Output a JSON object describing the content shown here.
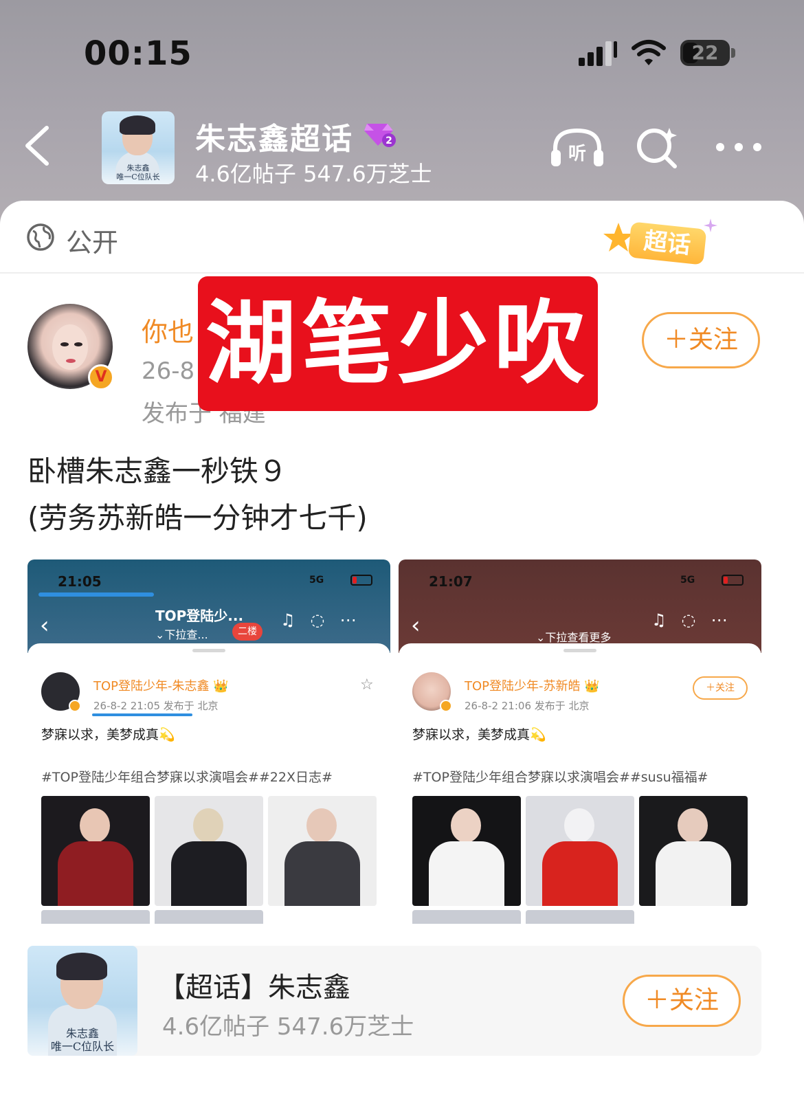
{
  "status_bar": {
    "time": "00:15",
    "battery": "22"
  },
  "header": {
    "topic_title": "朱志鑫超话",
    "topic_stats": "4.6亿帖子 547.6万芝士",
    "thumb_caption": "唯一C位队长",
    "thumb_name": "朱志鑫"
  },
  "privacy": {
    "label": "公开",
    "badge": "超话"
  },
  "post": {
    "author_name": "你也",
    "date": "26-8",
    "location": "发布于 福建",
    "follow_label": "＋关注",
    "stamp_text": "湖笔少吹",
    "text": "卧槽朱志鑫一秒铁９\n(劳务苏新皓一分钟才七千)"
  },
  "screenshots": [
    {
      "time": "21:05",
      "network": "5G",
      "title": "TOP登陆少...",
      "subtitle": "⌄下拉查...",
      "floor": "二楼",
      "author": "TOP登陆少年-朱志鑫 👑",
      "meta": "26-8-2 21:05  发布于 北京",
      "text": "梦寐以求，美梦成真💫",
      "tags": "#TOP登陆少年组合梦寐以求演唱会##22X日志#"
    },
    {
      "time": "21:07",
      "network": "5G",
      "subtitle": "⌄下拉查看更多",
      "author": "TOP登陆少年-苏新皓 👑",
      "meta": "26-8-2 21:06  发布于 北京",
      "follow": "＋关注",
      "text": "梦寐以求，美梦成真💫",
      "tags": "#TOP登陆少年组合梦寐以求演唱会##susu福福#"
    }
  ],
  "bottom_card": {
    "title": "【超话】朱志鑫",
    "stats": "4.6亿帖子 547.6万芝士",
    "follow_label": "＋关注"
  },
  "colors": {
    "accent": "#f08a24",
    "stamp": "#e8101c",
    "header_bg": "#a9a5ad"
  }
}
